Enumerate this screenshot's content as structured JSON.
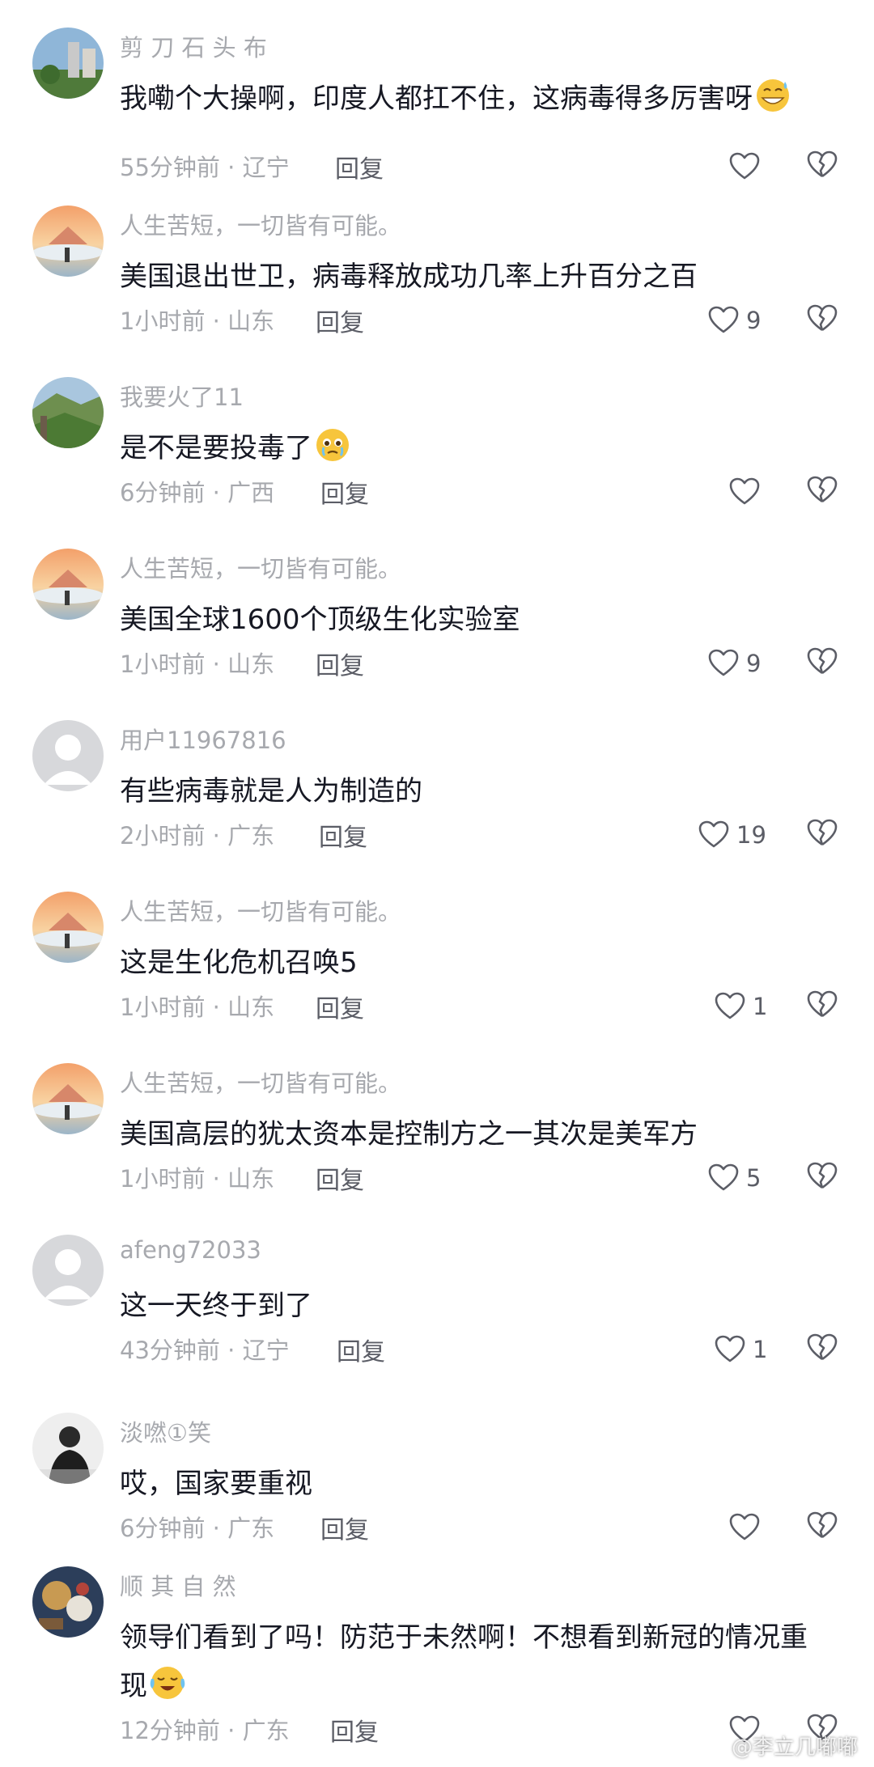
{
  "comments": [
    {
      "user": "剪 刀 石 头 布",
      "text": "我嘞个大操啊，印度人都扛不住，这病毒得多厉害呀",
      "emoji": "grin-sweat-emoji",
      "time": "55分钟前",
      "location": "辽宁",
      "reply": "回复",
      "likes": ""
    },
    {
      "user": "人生苦短，一切皆有可能。",
      "text": "美国退出世卫，病毒释放成功几率上升百分之百",
      "time": "1小时前",
      "location": "山东",
      "reply": "回复",
      "likes": "9"
    },
    {
      "user": "我要火了11",
      "text": "是不是要投毒了",
      "emoji": "tearful-emoji",
      "time": "6分钟前",
      "location": "广西",
      "reply": "回复",
      "likes": ""
    },
    {
      "user": "人生苦短，一切皆有可能。",
      "text": "美国全球1600个顶级生化实验室",
      "time": "1小时前",
      "location": "山东",
      "reply": "回复",
      "likes": "9"
    },
    {
      "user": "用户11967816",
      "text": "有些病毒就是人为制造的",
      "time": "2小时前",
      "location": "广东",
      "reply": "回复",
      "likes": "19"
    },
    {
      "user": "人生苦短，一切皆有可能。",
      "text": "这是生化危机召唤5",
      "time": "1小时前",
      "location": "山东",
      "reply": "回复",
      "likes": "1"
    },
    {
      "user": "人生苦短，一切皆有可能。",
      "text": "美国高层的犹太资本是控制方之一其次是美军方",
      "time": "1小时前",
      "location": "山东",
      "reply": "回复",
      "likes": "5"
    },
    {
      "user": "afeng72033",
      "text": "这一天终于到了",
      "time": "43分钟前",
      "location": "辽宁",
      "reply": "回复",
      "likes": "1"
    },
    {
      "user": "淡嘫①笑",
      "text": "哎，国家要重视",
      "time": "6分钟前",
      "location": "广东",
      "reply": "回复",
      "likes": ""
    },
    {
      "user": "顺 其 自 然",
      "text": "领导们看到了吗！防范于未然啊！不想看到新冠的情况重现",
      "emoji": "crying-laugh-emoji",
      "time": "12分钟前",
      "location": "广东",
      "reply": "回复",
      "likes": ""
    }
  ],
  "separator": " · ",
  "watermark": "@李立几嘟嘟",
  "colors": {
    "background": "#ffffff",
    "username": "#a7a9ae",
    "comment_text": "#161823",
    "meta": "#a7a9ae",
    "action": "#5b5d66"
  }
}
